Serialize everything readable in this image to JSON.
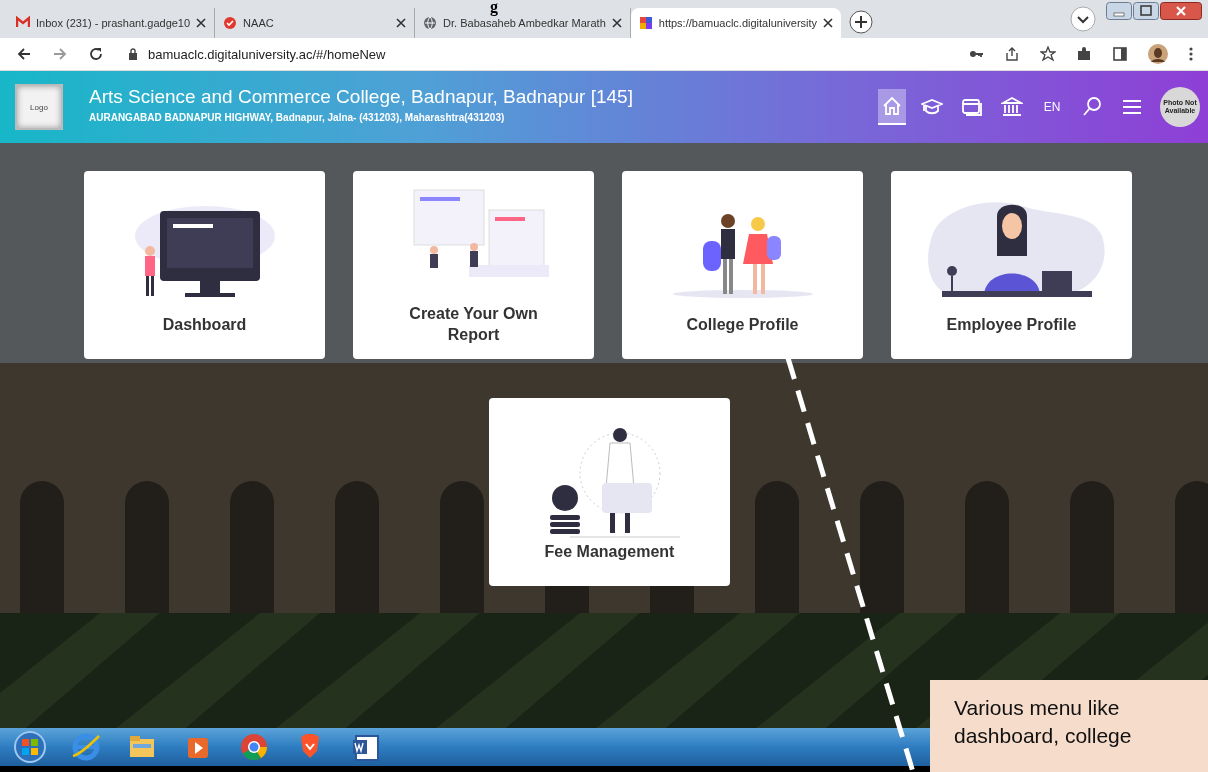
{
  "doc_fragment": "g",
  "browser": {
    "tabs": [
      {
        "title": "Inbox (231) - prashant.gadge10",
        "kind": "mail",
        "selected": false
      },
      {
        "title": "NAAC",
        "kind": "badge",
        "selected": false
      },
      {
        "title": "Dr. Babasaheb Ambedkar Marath",
        "kind": "globe",
        "selected": false
      },
      {
        "title": "https://bamuaclc.digitaluniversity",
        "kind": "grid",
        "selected": true
      }
    ],
    "address": "bamuaclc.digitaluniversity.ac/#/homeNew"
  },
  "header": {
    "logo": "Logo",
    "title": "Arts Science and Commerce College, Badnapur, Badnapur [145]",
    "address": "AURANGABAD BADNAPUR HIGHWAY, Badnapur, Jalna- (431203), Maharashtra(431203)",
    "nav": [
      {
        "kind": "home",
        "selected": true
      },
      {
        "kind": "cap",
        "selected": false
      },
      {
        "kind": "cards",
        "selected": false
      },
      {
        "kind": "bank",
        "selected": false
      },
      {
        "kind": "text",
        "label": "EN",
        "selected": false
      },
      {
        "kind": "search",
        "selected": false
      },
      {
        "kind": "menu",
        "selected": false
      }
    ],
    "avatar": "Photo Not Available"
  },
  "cards": [
    {
      "label": "Dashboard",
      "kind": "dashboard"
    },
    {
      "label": "Create Your Own Report",
      "kind": "report"
    },
    {
      "label": "College Profile",
      "kind": "people"
    },
    {
      "label": "Employee Profile",
      "kind": "employee"
    },
    {
      "label": "Fee Management",
      "kind": "fee"
    }
  ],
  "taskbar": [
    {
      "kind": "start"
    },
    {
      "kind": "ie"
    },
    {
      "kind": "folder"
    },
    {
      "kind": "media"
    },
    {
      "kind": "chrome"
    },
    {
      "kind": "brave"
    },
    {
      "kind": "word"
    }
  ],
  "annotation": "Various menu like dashboard, college"
}
